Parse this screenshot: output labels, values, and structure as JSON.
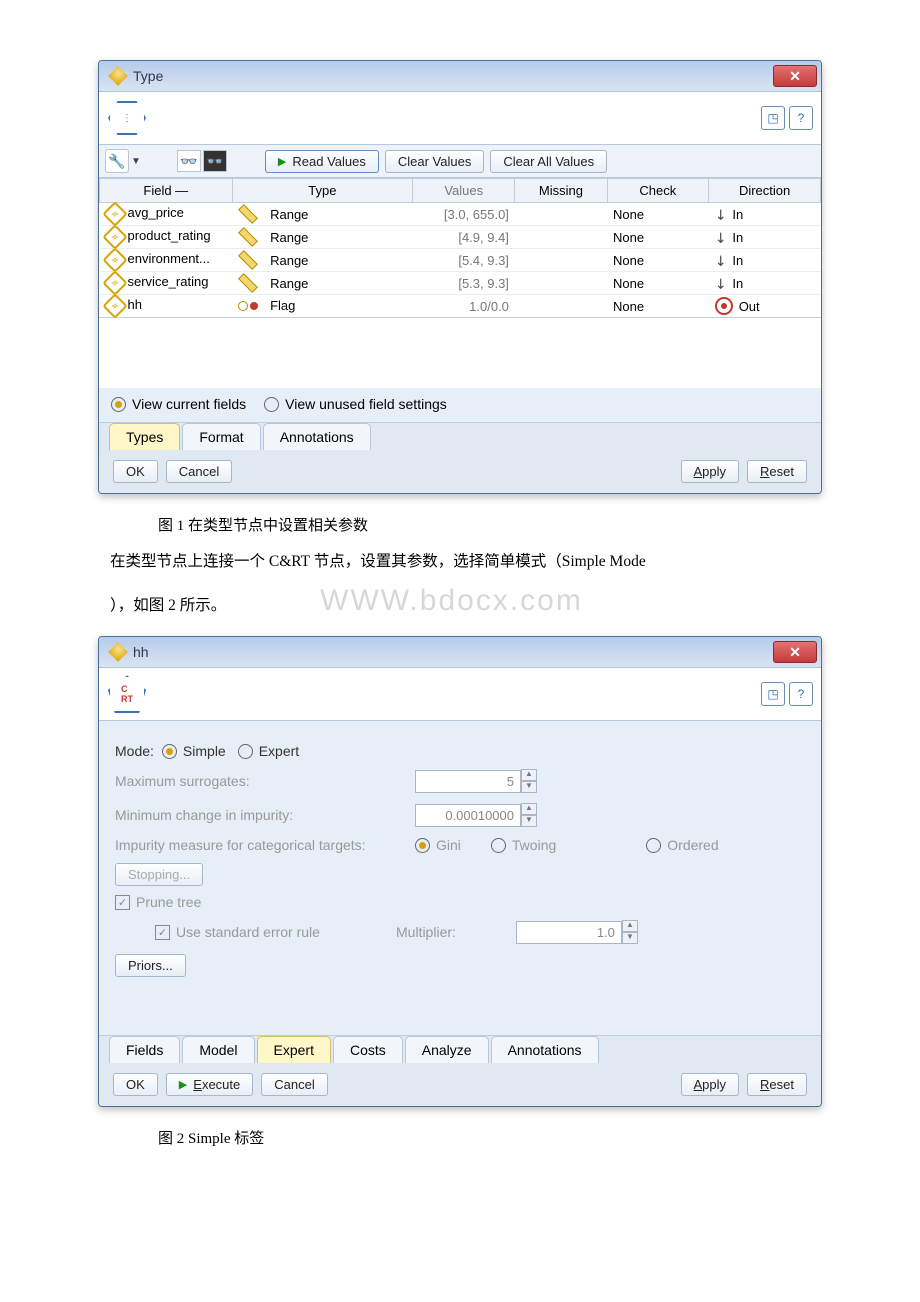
{
  "dialog1": {
    "title": "Type",
    "toolbar": {
      "read": "Read Values",
      "clear": "Clear Values",
      "clear_all": "Clear All Values"
    },
    "columns": {
      "field": "Field —",
      "type": "Type",
      "values": "Values",
      "missing": "Missing",
      "check": "Check",
      "direction": "Direction"
    },
    "rows": [
      {
        "field": "avg_price",
        "type": "Range",
        "values": "[3.0, 655.0]",
        "check": "None",
        "dir": "In"
      },
      {
        "field": "product_rating",
        "type": "Range",
        "values": "[4.9, 9.4]",
        "check": "None",
        "dir": "In"
      },
      {
        "field": "environment...",
        "type": "Range",
        "values": "[5.4, 9.3]",
        "check": "None",
        "dir": "In"
      },
      {
        "field": "service_rating",
        "type": "Range",
        "values": "[5.3, 9.3]",
        "check": "None",
        "dir": "In"
      },
      {
        "field": "hh",
        "type": "Flag",
        "values": "1.0/0.0",
        "check": "None",
        "dir": "Out"
      }
    ],
    "view": {
      "current": "View current fields",
      "unused": "View unused field settings"
    },
    "tabs": [
      "Types",
      "Format",
      "Annotations"
    ],
    "active_tab": "Types",
    "buttons": {
      "ok": "OK",
      "cancel": "Cancel",
      "apply": "Apply",
      "reset": "Reset"
    }
  },
  "caption1": "图 1 在类型节点中设置相关参数",
  "paragraph_line1": "  在类型节点上连接一个 C&RT 节点，设置其参数，选择简单模式（Simple Mode",
  "paragraph_line2": "），如图 2 所示。",
  "watermark": "WWW.bdocx.com",
  "dialog2": {
    "title": "hh",
    "mode_label": "Mode:",
    "mode_simple": "Simple",
    "mode_expert": "Expert",
    "max_surrogates": {
      "label": "Maximum surrogates:",
      "value": "5"
    },
    "min_impurity": {
      "label": "Minimum change in impurity:",
      "value": "0.00010000"
    },
    "impurity_measure": {
      "label": "Impurity measure for categorical targets:",
      "gini": "Gini",
      "twoing": "Twoing",
      "ordered": "Ordered"
    },
    "stopping": "Stopping...",
    "prune": "Prune tree",
    "std_err": "Use standard error rule",
    "multiplier": {
      "label": "Multiplier:",
      "value": "1.0"
    },
    "priors": "Priors...",
    "tabs": [
      "Fields",
      "Model",
      "Expert",
      "Costs",
      "Analyze",
      "Annotations"
    ],
    "active_tab": "Expert",
    "buttons": {
      "ok": "OK",
      "execute": "Execute",
      "cancel": "Cancel",
      "apply": "Apply",
      "reset": "Reset"
    }
  },
  "caption2": "图 2 Simple 标签"
}
